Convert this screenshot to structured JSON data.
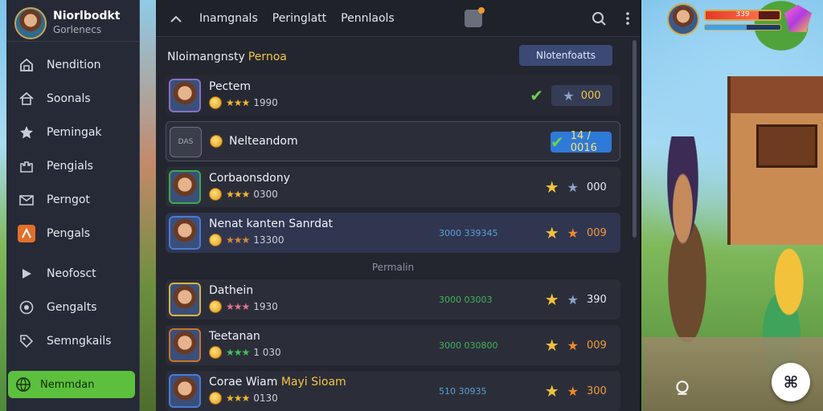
{
  "profile": {
    "name": "Niorlbodkt",
    "subtitle": "Gorlenecs"
  },
  "sidebar": {
    "items": [
      {
        "label": "Nendition",
        "icon": "home-icon"
      },
      {
        "label": "Soonals",
        "icon": "house-icon"
      },
      {
        "label": "Pemingak",
        "icon": "star-icon"
      },
      {
        "label": "Pengials",
        "icon": "castle-icon"
      },
      {
        "label": "Perngot",
        "icon": "mail-icon"
      },
      {
        "label": "Pengals",
        "icon": "map-icon"
      },
      {
        "label": "Neofosct",
        "icon": "play-icon"
      },
      {
        "label": "Gengalts",
        "icon": "target-icon"
      },
      {
        "label": "Semngkails",
        "icon": "tag-icon"
      }
    ],
    "active": {
      "label": "Nemmdan",
      "icon": "globe-icon"
    }
  },
  "topbar": {
    "tabs": [
      "Inamgnals",
      "Peringlatt",
      "Pennlaols"
    ]
  },
  "section": {
    "title": "Nloimangnsty",
    "highlight": "Pernoa",
    "button": "Nlotenfoatts"
  },
  "rows": [
    {
      "name": "Pectem",
      "stars": "★★★",
      "score": "1990",
      "mid": "",
      "right_value": "000"
    },
    {
      "name": "Nelteandom",
      "tool_label": "DAS",
      "pill_value": "14 / 0016"
    },
    {
      "name": "Corbaonsdony",
      "stars": "★★★",
      "score": "0300",
      "mid": "",
      "right_value": "000"
    },
    {
      "name": "Nenat kanten Sanrdat",
      "stars": "★★★",
      "score": "13300",
      "mid": "3000 339345",
      "right_value": "009"
    },
    {
      "name": "Dathein",
      "stars": "★★★",
      "score": "1930",
      "mid": "3000 03003",
      "right_value": "390"
    },
    {
      "name": "Teetanan",
      "stars": "★★★",
      "score": "1 030",
      "mid": "3000 030800",
      "right_value": "009"
    },
    {
      "name": "Corae Wiam",
      "name_highlight": "Mayi Sioam",
      "stars": "★★★",
      "score": "0130",
      "mid": "510 30935",
      "right_value": "300"
    }
  ],
  "divider": "Permalin",
  "hud": {
    "hp": "339",
    "hp_fraction": 0.72,
    "mana_fraction": 0.55
  },
  "colors": {
    "accent_green": "#5cc03d",
    "accent_blue": "#2e7ad8",
    "gold": "#f4c542"
  }
}
